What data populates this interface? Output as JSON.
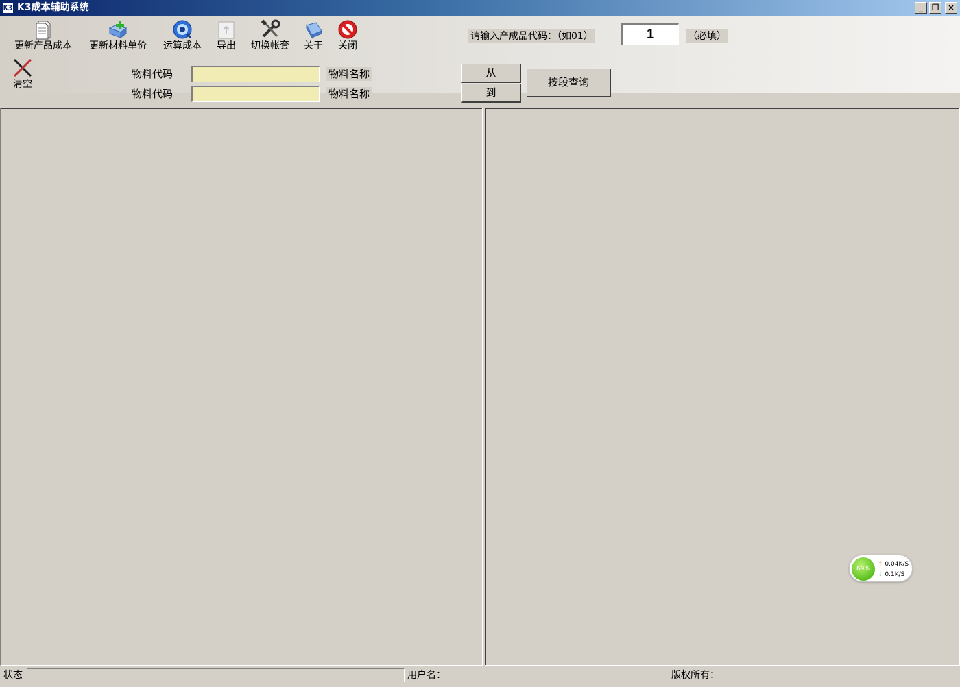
{
  "window": {
    "title": "K3成本辅助系统",
    "app_icon_text": "K3",
    "minimize_glyph": "_",
    "restore_glyph": "❐",
    "close_glyph": "×"
  },
  "toolbar": {
    "update_product_cost": "更新产品成本",
    "update_material_price": "更新材料单价",
    "calculate_cost": "运算成本",
    "export": "导出",
    "switch_account": "切换帐套",
    "about": "关于",
    "close": "关闭",
    "clear": "清空"
  },
  "query": {
    "material_code_label": "物料代码",
    "material_name_label": "物料名称",
    "material_code_from": "",
    "material_code_to": "",
    "from_button": "从",
    "to_button": "到",
    "range_query_button": "按段查询",
    "product_code_prompt": "请输入产成品代码：（如01）",
    "product_code_value": "1",
    "required_hint": "（必填）"
  },
  "status_bar": {
    "status_label": "状态",
    "status_value": "",
    "username_label": "用户名：",
    "copyright_label": "版权所有："
  },
  "net_widget": {
    "percent": "69%",
    "upload": "0.04K/S",
    "download": "0.1K/S"
  },
  "colors": {
    "field_yellow": "#f0ecb4",
    "window_face": "#d4d0c8",
    "title_dark": "#0a246a"
  }
}
